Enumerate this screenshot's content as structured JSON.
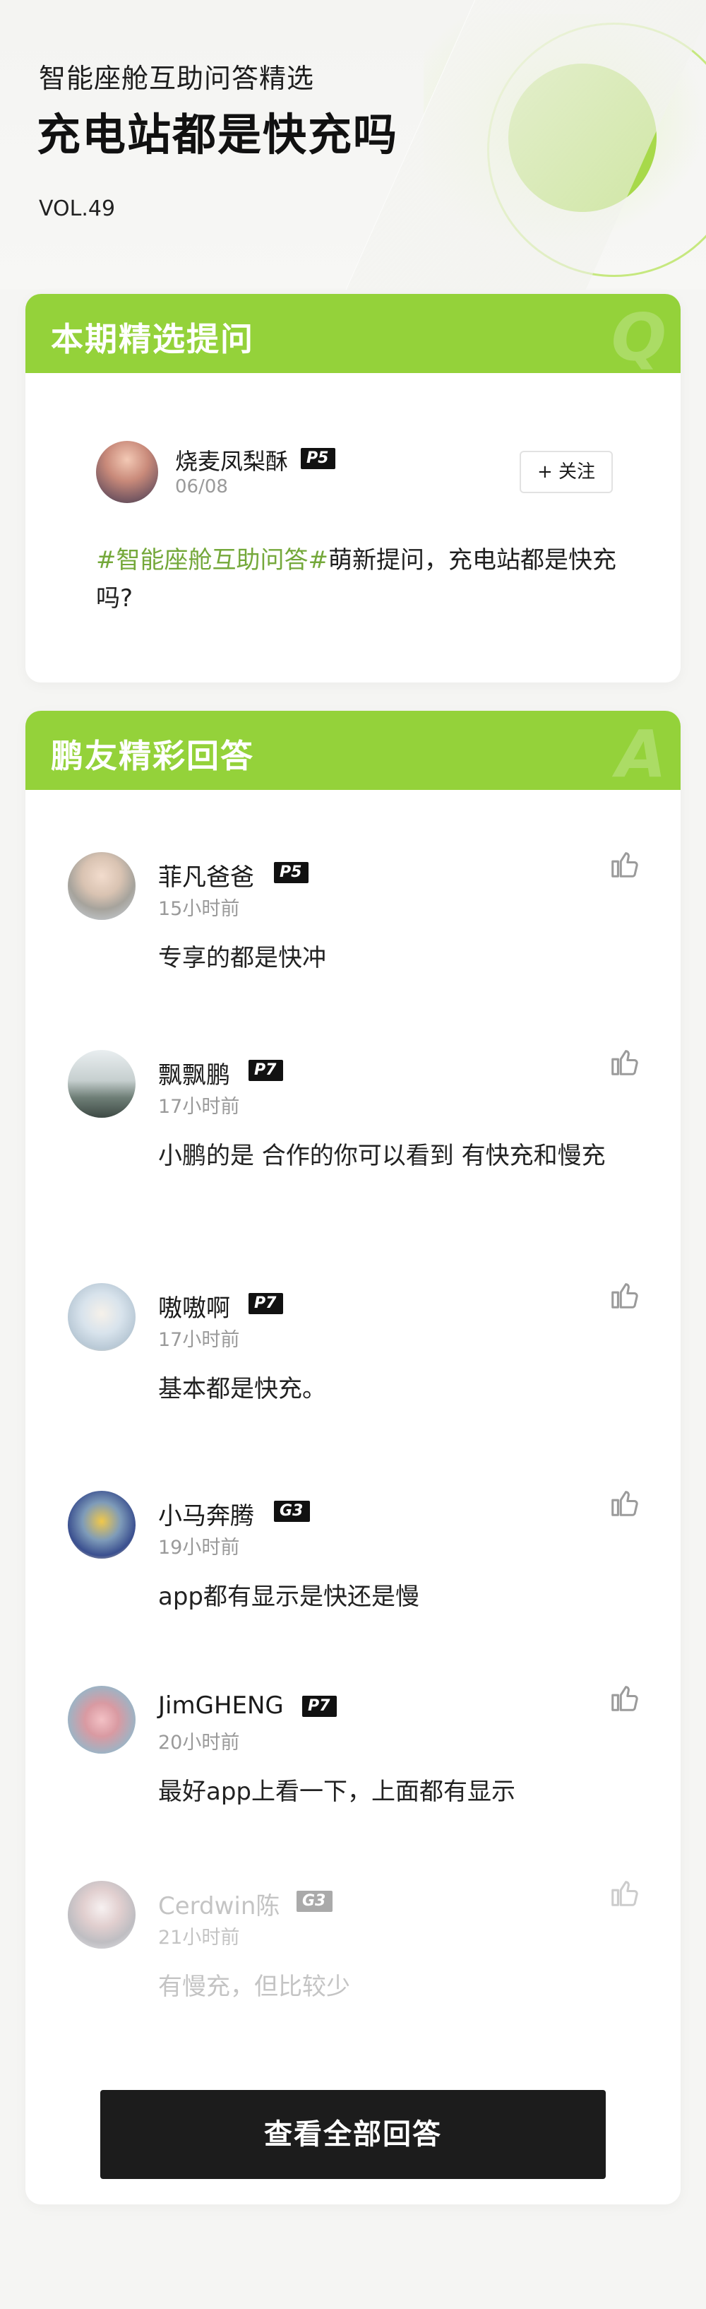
{
  "header": {
    "subtitle": "智能座舱互助问答精选",
    "title": "充电站都是快充吗",
    "volume": "VOL.49"
  },
  "question_card": {
    "title": "本期精选提问",
    "watermark_letter": "Q",
    "author": {
      "name": "烧麦凤梨酥",
      "level": "P5",
      "date": "06/08"
    },
    "follow_label": "+ 关注",
    "hashtag": "#智能座舱互助问答#",
    "text": "萌新提问，充电站都是快充吗?"
  },
  "answers_card": {
    "title": "鹏友精彩回答",
    "watermark_letter": "A",
    "answers": [
      {
        "name": "菲凡爸爸",
        "level": "P5",
        "time": "15小时前",
        "text": "专享的都是快冲"
      },
      {
        "name": "飘飘鹏",
        "level": "P7",
        "time": "17小时前",
        "text": "小鹏的是  合作的你可以看到 有快充和慢充"
      },
      {
        "name": "嗷嗷啊",
        "level": "P7",
        "time": "17小时前",
        "text": "基本都是快充。"
      },
      {
        "name": "小马奔腾",
        "level": "G3",
        "time": "19小时前",
        "text": "app都有显示是快还是慢"
      },
      {
        "name": "JimGHENG",
        "level": "P7",
        "time": "20小时前",
        "text": "最好app上看一下，上面都有显示"
      },
      {
        "name": "Cerdwin陈",
        "level": "G3",
        "time": "21小时前",
        "text": "有慢充，但比较少"
      }
    ],
    "view_all_label": "查看全部回答"
  },
  "colors": {
    "accent": "#94d23a",
    "hashtag": "#74a83a",
    "button_dark": "#1c1c1c"
  },
  "icons": {
    "like": "thumbs-up-icon"
  }
}
